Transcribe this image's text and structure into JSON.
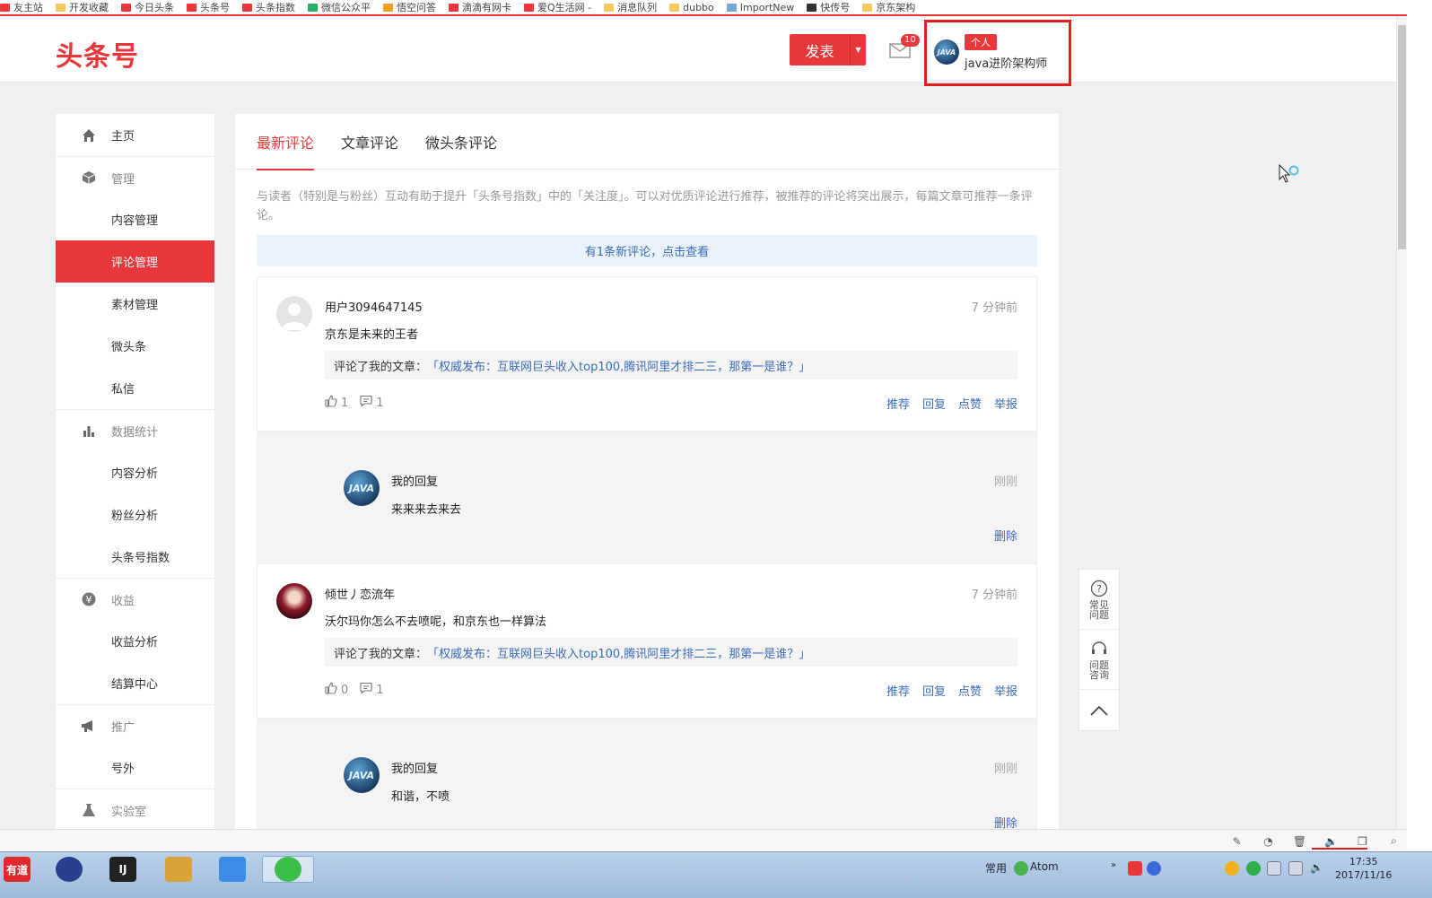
{
  "bookmarks": [
    {
      "label": "友主站",
      "color": "#e8373a"
    },
    {
      "label": "开发收藏",
      "color": "#f4c95d"
    },
    {
      "label": "今日头条",
      "color": "#e8373a"
    },
    {
      "label": "头条号",
      "color": "#e8373a"
    },
    {
      "label": "头条指数",
      "color": "#e8373a"
    },
    {
      "label": "微信公众平",
      "color": "#2aae67"
    },
    {
      "label": "悟空问答",
      "color": "#f0a020"
    },
    {
      "label": "滴滴有网卡",
      "color": "#e8373a"
    },
    {
      "label": "爱Q生活网 -",
      "color": "#e8373a"
    },
    {
      "label": "消息队列",
      "color": "#f4c95d"
    },
    {
      "label": "dubbo",
      "color": "#f4c95d"
    },
    {
      "label": "ImportNew",
      "color": "#7aa6d6"
    },
    {
      "label": "快传号",
      "color": "#333333"
    },
    {
      "label": "京东架构",
      "color": "#f4c95d"
    }
  ],
  "header": {
    "logo": "头条号",
    "publish_label": "发表",
    "mail_badge": "10",
    "user_tag": "个人",
    "user_name": "java进阶架构师",
    "avatar_text": "JAVA"
  },
  "sidebar": {
    "items": [
      {
        "label": "主页",
        "kind": "top",
        "icon": "home-icon"
      },
      {
        "label": "管理",
        "kind": "group",
        "icon": "cube-icon"
      },
      {
        "label": "内容管理",
        "kind": "sub"
      },
      {
        "label": "评论管理",
        "kind": "sub",
        "active": true
      },
      {
        "label": "素材管理",
        "kind": "sub"
      },
      {
        "label": "微头条",
        "kind": "sub"
      },
      {
        "label": "私信",
        "kind": "sub"
      },
      {
        "label": "数据统计",
        "kind": "group",
        "icon": "bar-chart-icon"
      },
      {
        "label": "内容分析",
        "kind": "sub"
      },
      {
        "label": "粉丝分析",
        "kind": "sub"
      },
      {
        "label": "头条号指数",
        "kind": "sub"
      },
      {
        "label": "收益",
        "kind": "group",
        "icon": "yen-icon"
      },
      {
        "label": "收益分析",
        "kind": "sub"
      },
      {
        "label": "结算中心",
        "kind": "sub"
      },
      {
        "label": "推广",
        "kind": "group",
        "icon": "megaphone-icon"
      },
      {
        "label": "号外",
        "kind": "sub"
      },
      {
        "label": "实验室",
        "kind": "group",
        "icon": "flask-icon"
      }
    ]
  },
  "tabs": [
    "最新评论",
    "文章评论",
    "微头条评论"
  ],
  "description": "与读者（特别是与粉丝）互动有助于提升「头条号指数」中的「关注度」。可以对优质评论进行推荐，被推荐的评论将突出展示，每篇文章可推荐一条评论。",
  "notice": "有1条新评论，点击查看",
  "comments": [
    {
      "user": "用户3094647145",
      "time": "7 分钟前",
      "text": "京东是未来的王者",
      "ref_prefix": "评论了我的文章：",
      "ref_article": "「权威发布：互联网巨头收入top100,腾讯阿里才排二三，那第一是谁？」",
      "likes": "1",
      "replies": "1",
      "actions": [
        "推荐",
        "回复",
        "点赞",
        "举报"
      ],
      "avatar": "default",
      "reply": {
        "user": "我的回复",
        "time": "刚刚",
        "text": "来来来去来去",
        "delete": "删除"
      }
    },
    {
      "user": "倾世丿恋流年",
      "time": "7 分钟前",
      "text": "沃尔玛你怎么不去喷呢，和京东也一样算法",
      "ref_prefix": "评论了我的文章：",
      "ref_article": "「权威发布：互联网巨头收入top100,腾讯阿里才排二三，那第一是谁？」",
      "likes": "0",
      "replies": "1",
      "actions": [
        "推荐",
        "回复",
        "点赞",
        "举报"
      ],
      "avatar": "photo",
      "reply": {
        "user": "我的回复",
        "time": "刚刚",
        "text": "和谐，不喷",
        "delete": "删除"
      }
    }
  ],
  "float_help": {
    "faq": [
      "常见",
      "问题"
    ],
    "consult": [
      "问题",
      "咨询"
    ]
  },
  "taskbar": {
    "apps": [
      {
        "label": "有道",
        "color": "#e0282d"
      },
      {
        "label": "",
        "color": "#2b3f8f"
      },
      {
        "label": "IJ",
        "color": "#222222"
      },
      {
        "label": "",
        "color": "#d9a23a"
      },
      {
        "label": "",
        "color": "#3d8de8"
      },
      {
        "label": "",
        "color": "#3cbf4a"
      }
    ],
    "tray_label_common": "常用",
    "tray_label_atom": "Atom",
    "time": "17:35",
    "date": "2017/11/16"
  }
}
